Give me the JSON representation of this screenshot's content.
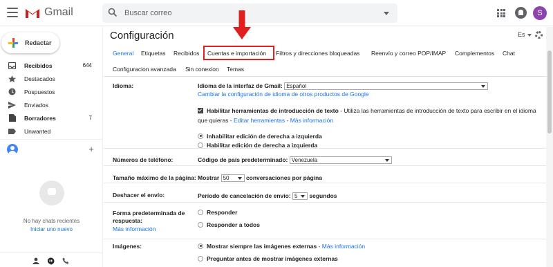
{
  "header": {
    "logo_text": "Gmail",
    "search_placeholder": "Buscar correo",
    "avatar_letter": "S"
  },
  "sidebar": {
    "compose_label": "Redactar",
    "items": [
      {
        "label": "Recibidos",
        "count": "644",
        "icon": "inbox-icon",
        "bold": true
      },
      {
        "label": "Destacados",
        "count": "",
        "icon": "star-icon",
        "bold": false
      },
      {
        "label": "Pospuestos",
        "count": "",
        "icon": "clock-icon",
        "bold": false
      },
      {
        "label": "Enviados",
        "count": "",
        "icon": "send-icon",
        "bold": false
      },
      {
        "label": "Borradores",
        "count": "7",
        "icon": "draft-icon",
        "bold": true
      },
      {
        "label": "Unwanted",
        "count": "",
        "icon": "label-icon",
        "bold": false
      }
    ],
    "no_chats": "No hay chats recientes",
    "start_new": "Iniciar uno nuevo"
  },
  "main": {
    "title": "Configuración",
    "language_short": "Es",
    "tabs_row1": [
      "General",
      "Etiquetas",
      "Recibidos",
      "Cuentas e importación",
      "Filtros y direcciones bloqueadas",
      "Reenvío y correo POP/IMAP",
      "Complementos",
      "Chat"
    ],
    "tabs_row2": [
      "Configuracion avanzada",
      "Sin conexion",
      "Temas"
    ],
    "active_tab": "General",
    "highlighted_tab": "Cuentas e importación",
    "settings": {
      "idioma": {
        "label": "Idioma:",
        "interface_label": "Idioma de la interfaz de Gmail:",
        "interface_value": "Español",
        "change_link": "Cambiar la configuración de idioma de otros productos de Google",
        "input_tools_bold": "Habilitar herramientas de introducción de texto",
        "input_tools_rest": " - Utiliza las herramientas de introducción de texto para escribir en el idioma",
        "input_tools_line2": "que quieras - ",
        "edit_tools_link": "Editar herramientas",
        "sep": " - ",
        "more_info_link": "Más información",
        "rtl_off": "Inhabilitar edición de derecha a izquierda",
        "rtl_on": "Habilitar edición de derecha a izquierda"
      },
      "telefono": {
        "label": "Números de teléfono:",
        "country_label": "Código de país predeterminado:",
        "country_value": "Venezuela"
      },
      "pagina": {
        "label": "Tamaño máximo de la página:",
        "show": "Mostrar",
        "value": "50",
        "suffix": "conversaciones por página"
      },
      "deshacer": {
        "label": "Deshacer el envío:",
        "period": "Período de cancelación de envío:",
        "value": "5",
        "suffix": "segundos"
      },
      "respuesta": {
        "label_line1": "Forma predeterminada de",
        "label_line2": "respuesta:",
        "more_info": "Más información",
        "reply": "Responder",
        "reply_all": "Responder a todos"
      },
      "imagenes": {
        "label": "Imágenes:",
        "always_show": "Mostrar siempre las imágenes externas",
        "more_info": "Más información",
        "ask": "Preguntar antes de mostrar imágenes externas"
      }
    }
  }
}
